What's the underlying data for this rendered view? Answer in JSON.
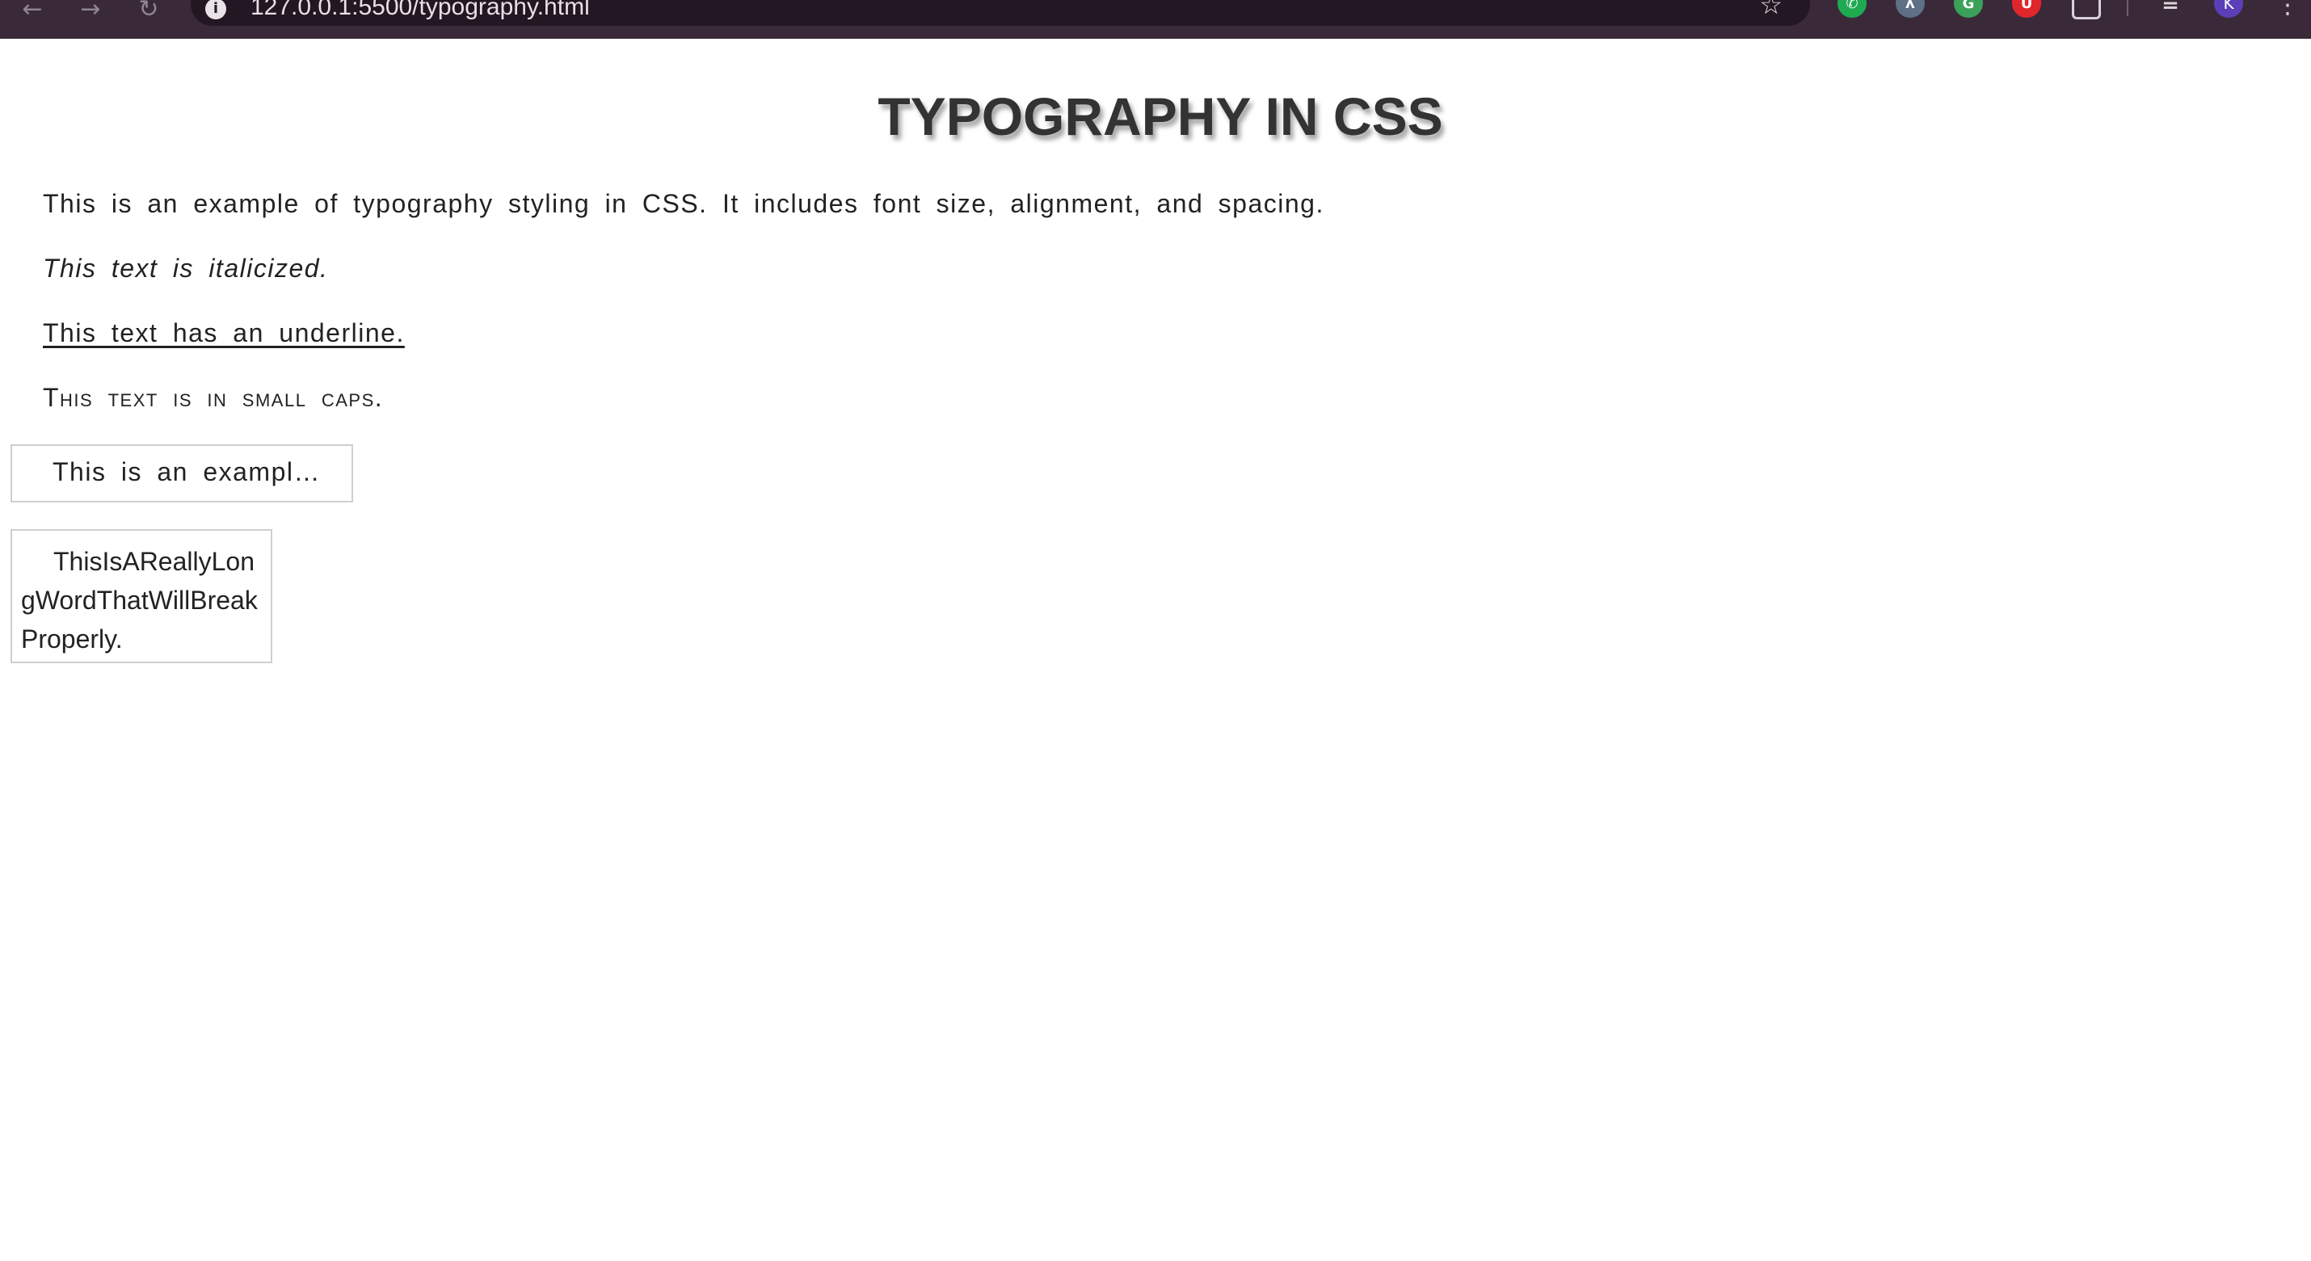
{
  "browser": {
    "url": "127.0.0.1:5500/typography.html",
    "back_icon": "arrow-left-icon",
    "forward_icon": "arrow-right-icon",
    "reload_icon": "reload-icon",
    "extensions": [
      {
        "name": "whatsapp-icon",
        "glyph": "✆"
      },
      {
        "name": "translate-icon",
        "glyph": "ʎ"
      },
      {
        "name": "grammar-icon",
        "glyph": "G"
      },
      {
        "name": "shield-icon",
        "glyph": "U"
      },
      {
        "name": "puzzle-icon",
        "glyph": ""
      },
      {
        "name": "media-icon",
        "glyph": "≡"
      }
    ],
    "avatar_letter": "K",
    "chrome_color": "#3a2a39"
  },
  "page": {
    "heading": "Typography in CSS",
    "intro": "This is an example of typography styling in CSS. It includes font size, alignment, and spacing.",
    "italic": "This text is italicized.",
    "underline": "This text has an underline.",
    "smallcaps": "This text is in small caps.",
    "ellipsis_box": "This is an example of text that will be truncated with an ellipsis when it overflows.",
    "wrap_box": "ThisIsAReallyLongWordThatWillBreakProperly."
  }
}
